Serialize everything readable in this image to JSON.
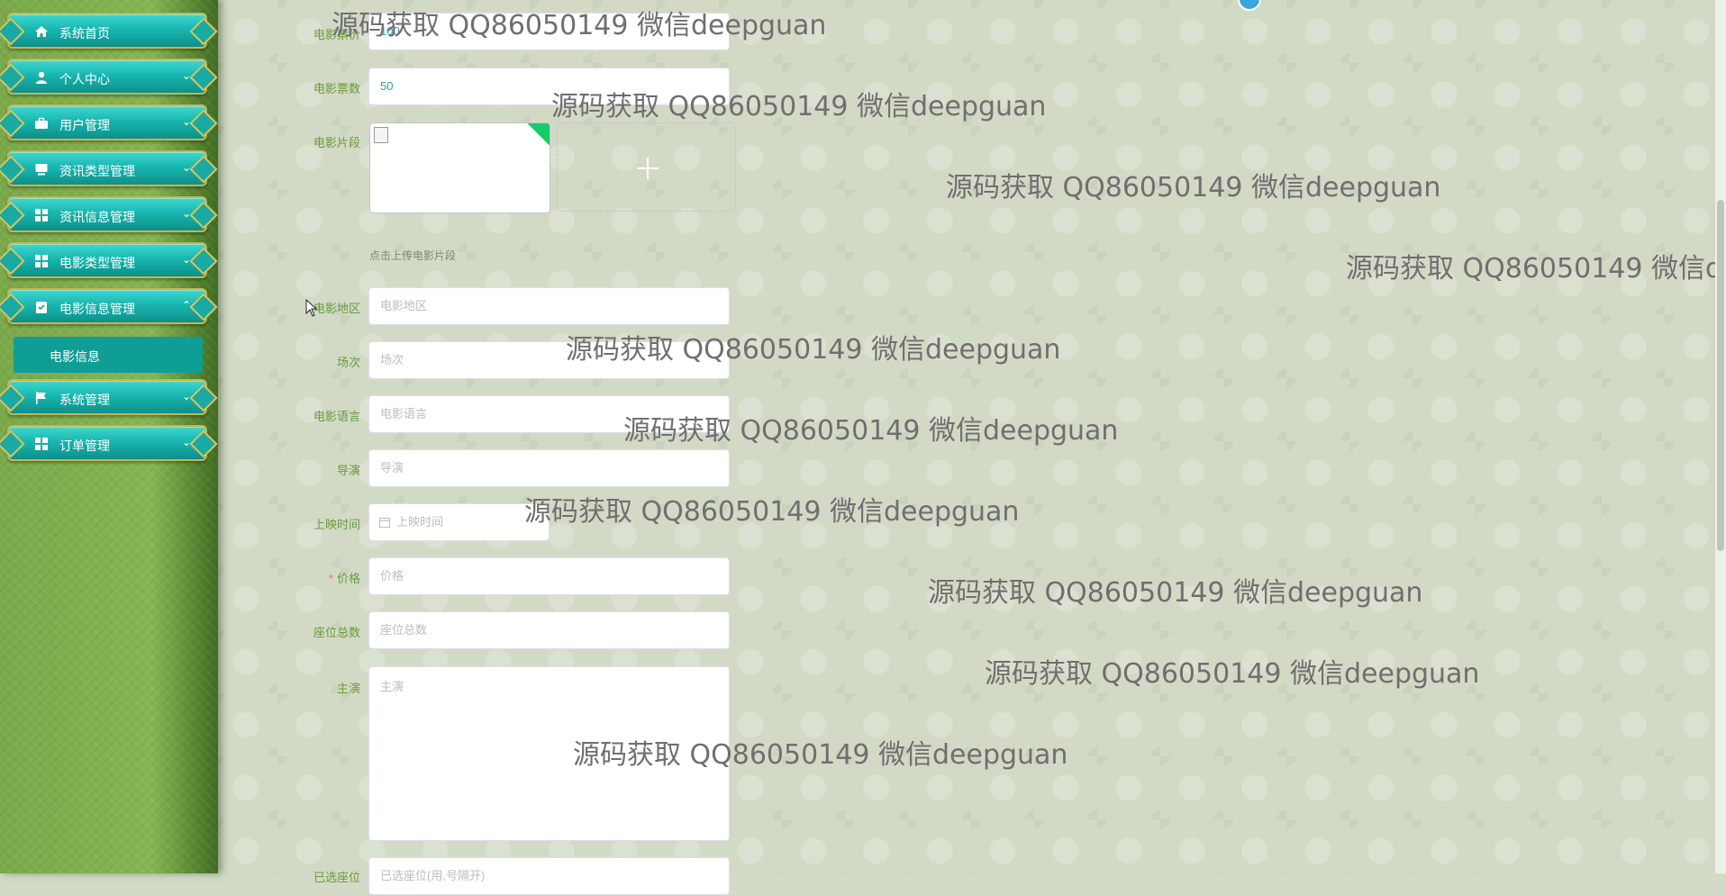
{
  "sidebar": {
    "items": [
      {
        "label": "系统首页",
        "icon": "home-icon"
      },
      {
        "label": "个人中心",
        "icon": "user-icon"
      },
      {
        "label": "用户管理",
        "icon": "briefcase-icon"
      },
      {
        "label": "资讯类型管理",
        "icon": "monitor-icon"
      },
      {
        "label": "资讯信息管理",
        "icon": "grid-icon"
      },
      {
        "label": "电影类型管理",
        "icon": "grid-icon"
      },
      {
        "label": "电影信息管理",
        "icon": "clipboard-icon"
      },
      {
        "label": "系统管理",
        "icon": "flag-icon"
      },
      {
        "label": "订单管理",
        "icon": "grid-icon"
      }
    ],
    "active_sub": "电影信息"
  },
  "form": {
    "price_top": {
      "label": "电影票价",
      "value": "100"
    },
    "tickets": {
      "label": "电影票数",
      "value": "50"
    },
    "clip": {
      "label": "电影片段",
      "hint": "点击上传电影片段"
    },
    "region": {
      "label": "电影地区",
      "placeholder": "电影地区"
    },
    "session": {
      "label": "场次",
      "placeholder": "场次"
    },
    "language": {
      "label": "电影语言",
      "placeholder": "电影语言"
    },
    "director": {
      "label": "导演",
      "placeholder": "导演"
    },
    "release": {
      "label": "上映时间",
      "placeholder": "上映时间"
    },
    "price": {
      "label": "价格",
      "required": "*",
      "placeholder": "价格"
    },
    "seats": {
      "label": "座位总数",
      "placeholder": "座位总数"
    },
    "cast": {
      "label": "主演",
      "placeholder": "主演"
    },
    "selected_seats": {
      "label": "已选座位",
      "placeholder": "已选座位(用,号隔开)"
    }
  },
  "watermark": "源码获取 QQ86050149 微信deepguan",
  "colors": {
    "accent": "#19b6b0",
    "label": "#6a9a3a",
    "sidebar": "#86b552",
    "required": "#f56c6c"
  }
}
